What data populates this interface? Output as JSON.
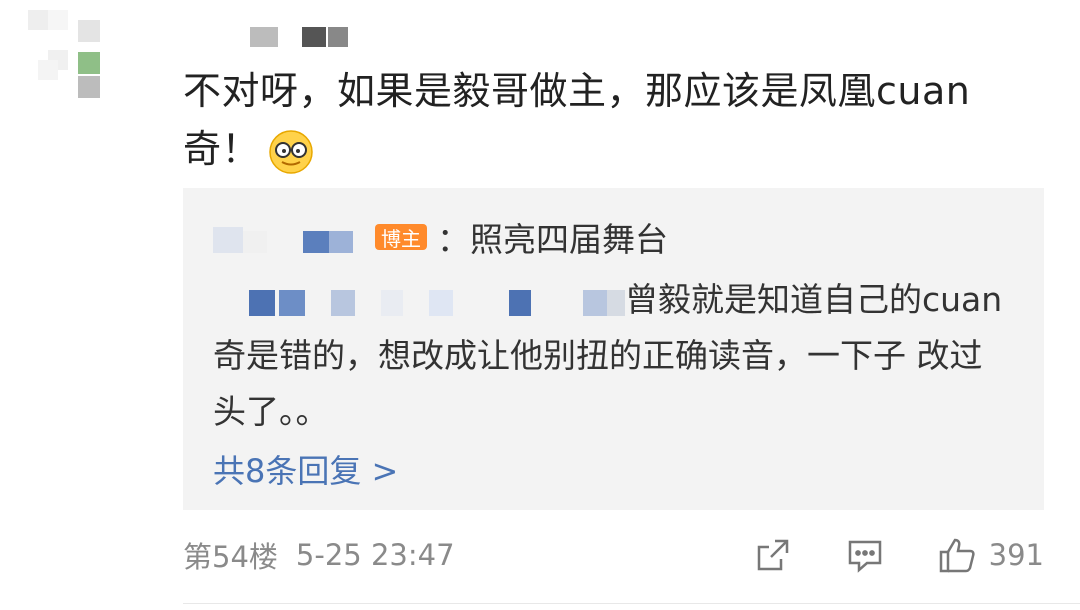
{
  "comment": {
    "text": "不对呀，如果是毅哥做主，那应该是凤凰cuan奇！",
    "emoji": "glasses-face-emoji"
  },
  "reply": {
    "badge": "博主",
    "colon_text": "：照亮四届舞台",
    "body_text_line1_suffix": "曾毅就是知道自己的",
    "body_text_rest": "cuan奇是错的，想改成让他别扭的正确读音，一下子 改过头了。。",
    "more_replies": "共8条回复 >"
  },
  "footer": {
    "floor": "第54楼",
    "timestamp": "5-25 23:47",
    "like_count": "391",
    "share_icon": "share-icon",
    "comment_icon": "comment-icon",
    "like_icon": "thumbs-up-icon"
  },
  "colors": {
    "badge_bg": "#ff8a2b",
    "link": "#4a74b5",
    "reply_bg": "#f3f3f3",
    "meta": "#8a8a8a"
  }
}
